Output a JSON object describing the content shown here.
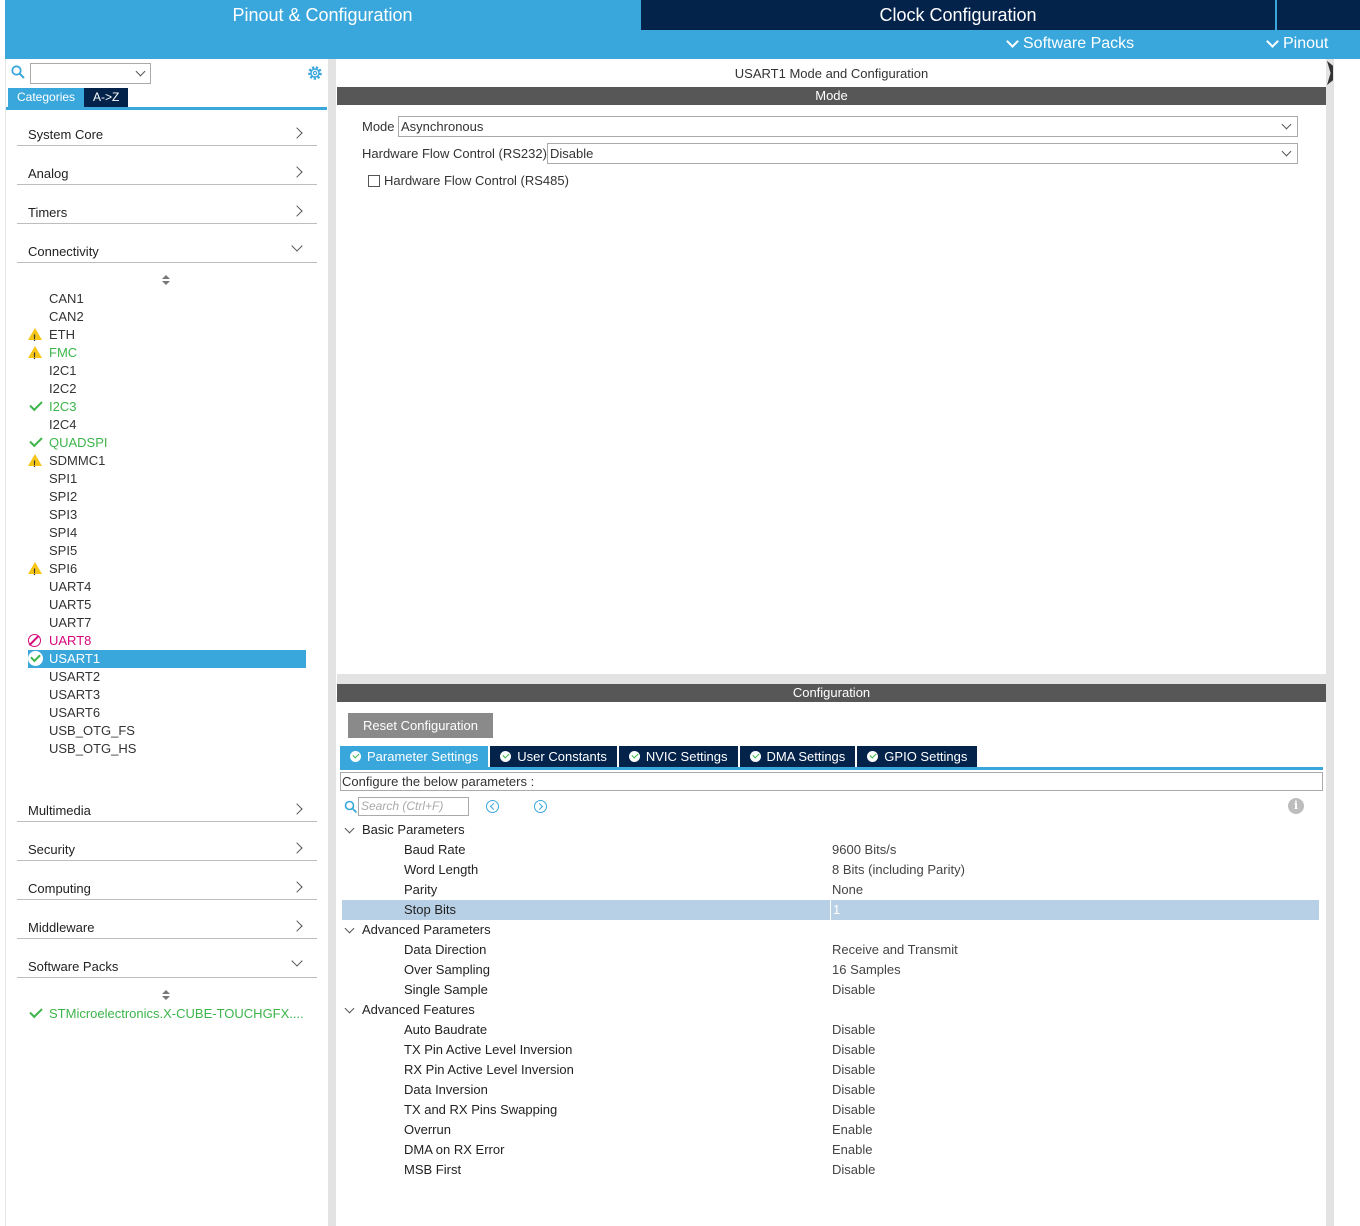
{
  "top_tabs": {
    "pinout_config": "Pinout & Configuration",
    "clock_config": "Clock Configuration"
  },
  "sub_menu": {
    "software_packs": "Software Packs",
    "pinout": "Pinout"
  },
  "left": {
    "search_value": "",
    "tabs": {
      "categories": "Categories",
      "az": "A->Z"
    },
    "categories": {
      "system_core": "System Core",
      "analog": "Analog",
      "timers": "Timers",
      "connectivity": "Connectivity",
      "multimedia": "Multimedia",
      "security": "Security",
      "computing": "Computing",
      "middleware": "Middleware",
      "software_packs": "Software Packs"
    },
    "connectivity_items": [
      {
        "name": "CAN1",
        "status": "none"
      },
      {
        "name": "CAN2",
        "status": "none"
      },
      {
        "name": "ETH",
        "status": "warning"
      },
      {
        "name": "FMC",
        "status": "warning-configured"
      },
      {
        "name": "I2C1",
        "status": "none"
      },
      {
        "name": "I2C2",
        "status": "none"
      },
      {
        "name": "I2C3",
        "status": "ok"
      },
      {
        "name": "I2C4",
        "status": "none"
      },
      {
        "name": "QUADSPI",
        "status": "ok"
      },
      {
        "name": "SDMMC1",
        "status": "warning"
      },
      {
        "name": "SPI1",
        "status": "none"
      },
      {
        "name": "SPI2",
        "status": "none"
      },
      {
        "name": "SPI3",
        "status": "none"
      },
      {
        "name": "SPI4",
        "status": "none"
      },
      {
        "name": "SPI5",
        "status": "none"
      },
      {
        "name": "SPI6",
        "status": "warning"
      },
      {
        "name": "UART4",
        "status": "none"
      },
      {
        "name": "UART5",
        "status": "none"
      },
      {
        "name": "UART7",
        "status": "none"
      },
      {
        "name": "UART8",
        "status": "error"
      },
      {
        "name": "USART1",
        "status": "selected"
      },
      {
        "name": "USART2",
        "status": "none"
      },
      {
        "name": "USART3",
        "status": "none"
      },
      {
        "name": "USART6",
        "status": "none"
      },
      {
        "name": "USB_OTG_FS",
        "status": "none"
      },
      {
        "name": "USB_OTG_HS",
        "status": "none"
      }
    ],
    "software_pack_item": "STMicroelectronics.X-CUBE-TOUCHGFX...."
  },
  "right": {
    "title": "USART1 Mode and Configuration",
    "mode_header": "Mode",
    "mode_label": "Mode",
    "mode_value": "Asynchronous",
    "hwfc232_label": "Hardware Flow Control (RS232)",
    "hwfc232_value": "Disable",
    "hwfc485_label": "Hardware Flow Control (RS485)",
    "hwfc485_checked": false,
    "config_header": "Configuration",
    "reset_button": "Reset Configuration",
    "config_tabs": [
      "Parameter Settings",
      "User Constants",
      "NVIC Settings",
      "DMA Settings",
      "GPIO Settings"
    ],
    "config_desc": "Configure the below parameters :",
    "search_placeholder": "Search (Ctrl+F)",
    "groups": [
      {
        "name": "Basic Parameters",
        "params": [
          {
            "name": "Baud Rate",
            "value": "9600 Bits/s"
          },
          {
            "name": "Word Length",
            "value": "8 Bits (including Parity)"
          },
          {
            "name": "Parity",
            "value": "None"
          },
          {
            "name": "Stop Bits",
            "value": "1"
          }
        ]
      },
      {
        "name": "Advanced Parameters",
        "params": [
          {
            "name": "Data Direction",
            "value": "Receive and Transmit"
          },
          {
            "name": "Over Sampling",
            "value": "16 Samples"
          },
          {
            "name": "Single Sample",
            "value": "Disable"
          }
        ]
      },
      {
        "name": "Advanced Features",
        "params": [
          {
            "name": "Auto Baudrate",
            "value": "Disable"
          },
          {
            "name": "TX Pin Active Level Inversion",
            "value": "Disable"
          },
          {
            "name": "RX Pin Active Level Inversion",
            "value": "Disable"
          },
          {
            "name": "Data Inversion",
            "value": "Disable"
          },
          {
            "name": "TX and RX Pins Swapping",
            "value": "Disable"
          },
          {
            "name": "Overrun",
            "value": "Enable"
          },
          {
            "name": "DMA on RX Error",
            "value": "Enable"
          },
          {
            "name": "MSB First",
            "value": "Disable"
          }
        ]
      }
    ],
    "selected_param": "Stop Bits"
  },
  "colors": {
    "accent": "#3aa7dc",
    "navy": "#03234b",
    "ok": "#3cb54a",
    "warning": "#f5c518",
    "error": "#d6087b"
  }
}
